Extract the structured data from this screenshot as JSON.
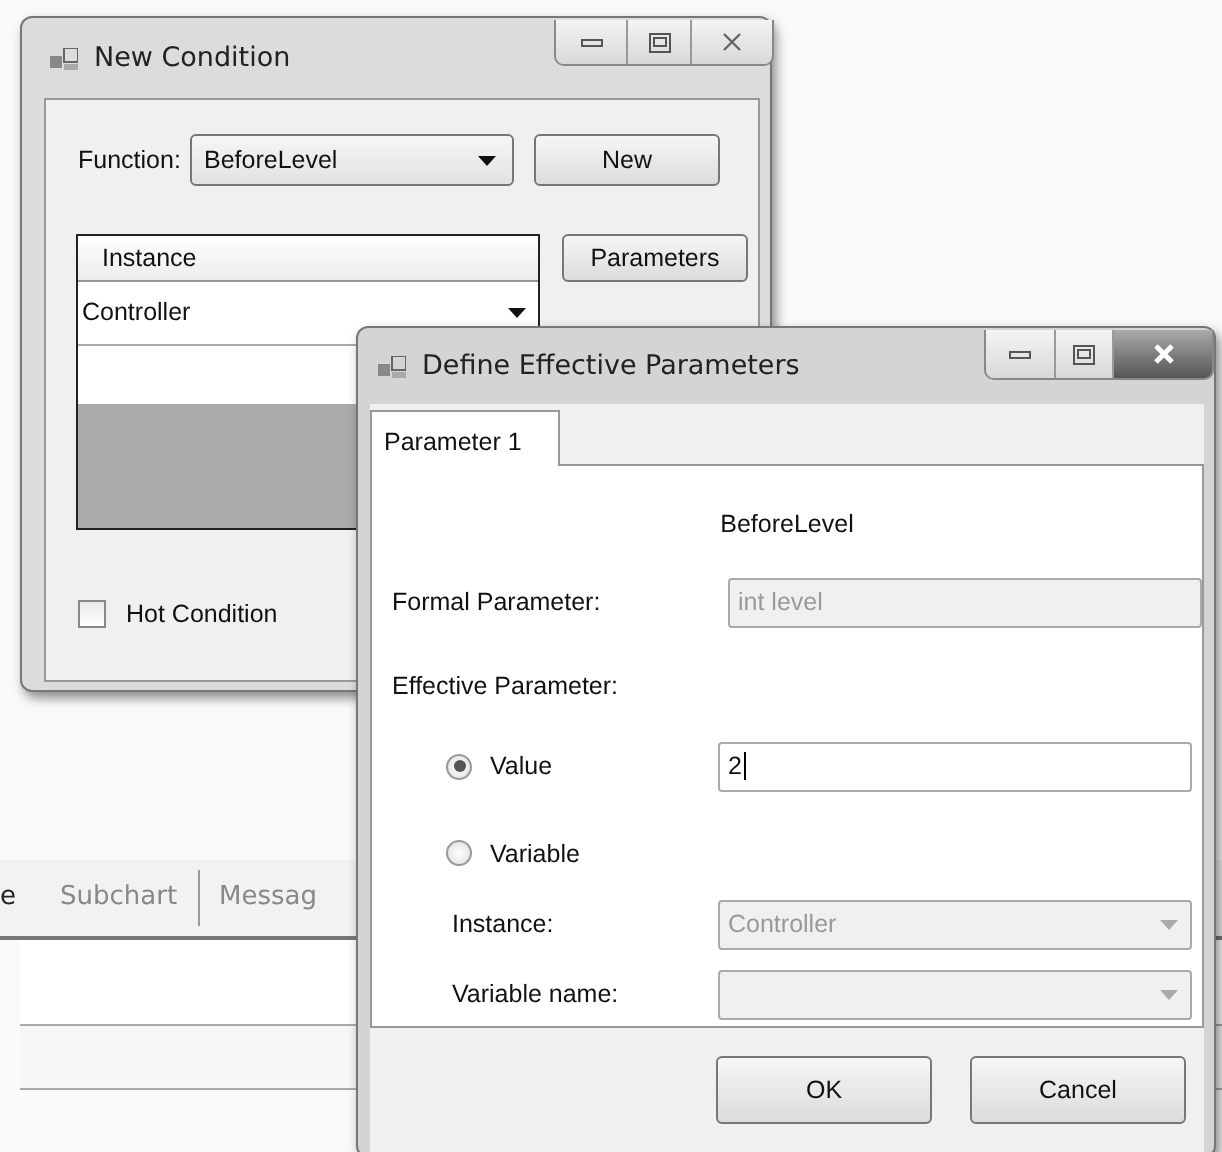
{
  "background": {
    "toolbar": [
      {
        "label": "e"
      },
      {
        "label": "Subchart"
      },
      {
        "label": "Messag"
      }
    ]
  },
  "new_condition": {
    "title": "New Condition",
    "function_label": "Function:",
    "function_value": "BeforeLevel",
    "new_button": "New",
    "grid": {
      "columns": [
        "Instance"
      ],
      "rows": [
        {
          "instance": "Controller"
        }
      ]
    },
    "parameters_button": "Parameters",
    "hot_condition": {
      "label": "Hot Condition",
      "checked": false
    }
  },
  "dialog": {
    "title": "Define Effective Parameters",
    "tabs": [
      {
        "label": "Parameter 1",
        "selected": true
      }
    ],
    "function_name": "BeforeLevel",
    "formal": {
      "label": "Formal Parameter:",
      "value": "int level"
    },
    "effective_label": "Effective Parameter:",
    "options": [
      {
        "label": "Value",
        "selected": true
      },
      {
        "label": "Variable",
        "selected": false
      }
    ],
    "value_field": "2",
    "instance": {
      "label": "Instance:",
      "value": "Controller",
      "disabled": true
    },
    "variable_name": {
      "label": "Variable name:",
      "disabled": true
    },
    "buttons": [
      "OK",
      "Cancel"
    ]
  }
}
